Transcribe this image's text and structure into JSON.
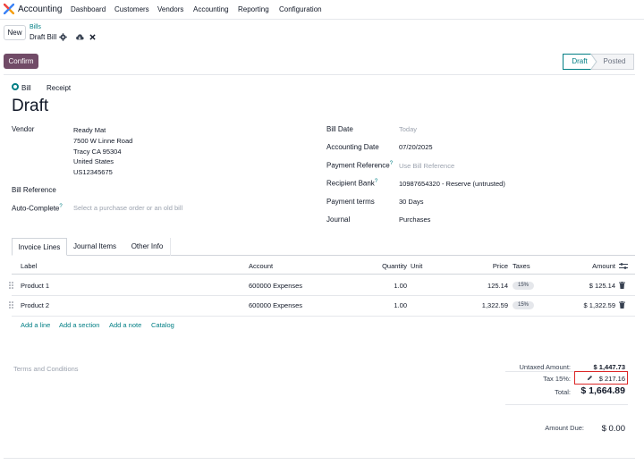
{
  "navbar": {
    "app_name": "Accounting",
    "menu": [
      "Dashboard",
      "Customers",
      "Vendors",
      "Accounting",
      "Reporting",
      "Configuration"
    ]
  },
  "control": {
    "new_label": "New",
    "breadcrumb_parent": "Bills",
    "breadcrumb_current": "Draft Bill",
    "confirm_label": "Confirm",
    "status_steps": [
      "Draft",
      "Posted"
    ]
  },
  "form": {
    "type_options": [
      "Bill",
      "Receipt"
    ],
    "title": "Draft",
    "vendor_label": "Vendor",
    "vendor_lines": [
      "Ready Mat",
      "7500 W Linne Road",
      "Tracy CA 95304",
      "United States",
      "US12345675"
    ],
    "bill_reference_label": "Bill Reference",
    "auto_complete_label": "Auto-Complete",
    "auto_complete_placeholder": "Select a purchase order or an old bill",
    "bill_date_label": "Bill Date",
    "bill_date_placeholder": "Today",
    "accounting_date_label": "Accounting Date",
    "accounting_date_value": "07/20/2025",
    "payment_reference_label": "Payment Reference",
    "payment_reference_placeholder": "Use Bill Reference",
    "recipient_bank_label": "Recipient Bank",
    "recipient_bank_value": "10987654320 - Reserve (untrusted)",
    "payment_terms_label": "Payment terms",
    "payment_terms_value": "30 Days",
    "journal_label": "Journal",
    "journal_value": "Purchases",
    "help_mark": "?"
  },
  "tabs": [
    "Invoice Lines",
    "Journal Items",
    "Other Info"
  ],
  "lines": {
    "headers": {
      "label": "Label",
      "account": "Account",
      "quantity": "Quantity",
      "unit": "Unit",
      "price": "Price",
      "taxes": "Taxes",
      "amount": "Amount"
    },
    "rows": [
      {
        "label": "Product 1",
        "account": "600000 Expenses",
        "quantity": "1.00",
        "price": "125.14",
        "tax": "15%",
        "amount": "$ 125.14"
      },
      {
        "label": "Product 2",
        "account": "600000 Expenses",
        "quantity": "1.00",
        "price": "1,322.59",
        "tax": "15%",
        "amount": "$ 1,322.59"
      }
    ],
    "add_links": [
      "Add a line",
      "Add a section",
      "Add a note",
      "Catalog"
    ]
  },
  "footer": {
    "terms_placeholder": "Terms and Conditions",
    "untaxed_label": "Untaxed Amount:",
    "untaxed_value": "$ 1,447.73",
    "tax_label": "Tax 15%:",
    "tax_value": "$ 217.16",
    "total_label": "Total:",
    "total_value": "$ 1,664.89",
    "amount_due_label": "Amount Due:",
    "amount_due_value": "$ 0.00"
  },
  "colors": {
    "brand": "#714b67",
    "link": "#017e84",
    "highlight_box": "#dc2626"
  }
}
